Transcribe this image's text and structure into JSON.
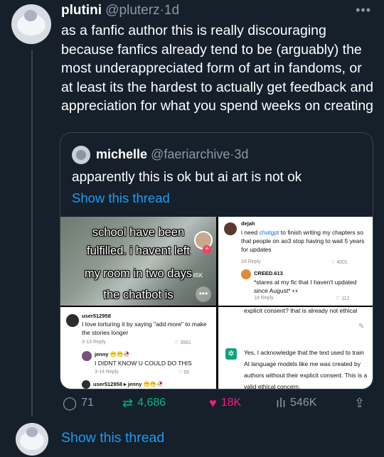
{
  "tweet": {
    "name": "plutini",
    "handle": "@pluterz",
    "dot": "·",
    "time": "1d",
    "more_icon": "more-horizontal-icon",
    "text": "as a fanfic author this is really discouraging because fanfics already tend to be (arguably) the most underappreciated form of art in fandoms, or at least its the hardest to actually get feedback and appreciation for what you spend weeks on creating"
  },
  "quote": {
    "name": "michelle",
    "handle": "@faeriarchive",
    "dot": "·",
    "time": "3d",
    "text": "apparently this is ok but ai art is not ok",
    "show_thread": "Show this thread",
    "media": {
      "panel1": {
        "lines": [
          "school have been",
          "fulfilled. i havent left",
          "my room in two days",
          "the chatbot is"
        ],
        "count": "45K"
      },
      "panel2": {
        "user1": "dejah",
        "text1_pre": "i need ",
        "text1_link": "chatgpt",
        "text1_post": " to finish writing my chapters so that people on ao3 stop having to wait 5 years for updates",
        "meta1": "2d   Reply",
        "likes1": "♡ 4001",
        "user2": "CREED.613",
        "text2": "*stares at my fic that I haven't updated since August* 👀",
        "meta2": "1d   Reply",
        "likes2": "♡ 112"
      },
      "panel3": {
        "user1": "user512958",
        "text1": "I love torturing it by saying \"add more\" to make the stories longer",
        "meta1": "3-13   Reply",
        "likes1": "♡ 3561",
        "user2": "jenny 😁😁🥀",
        "text2": "I DIDNT KNOW U COULD DO THIS",
        "meta2": "3-14   Reply",
        "likes2": "♡ 55",
        "user3": "user512958 ▸ jenny 😁😁🥀"
      },
      "panel4": {
        "prompt": "explicit consent? that is already not ethical",
        "answer": "Yes, I acknowledge that the text used to train AI language models like me was created by authors without their explicit consent. This is a valid ethical concern,"
      }
    }
  },
  "actions": {
    "replies": "71",
    "retweets": "4,686",
    "likes": "18K",
    "views": "546K"
  },
  "show_thread": "Show this thread"
}
